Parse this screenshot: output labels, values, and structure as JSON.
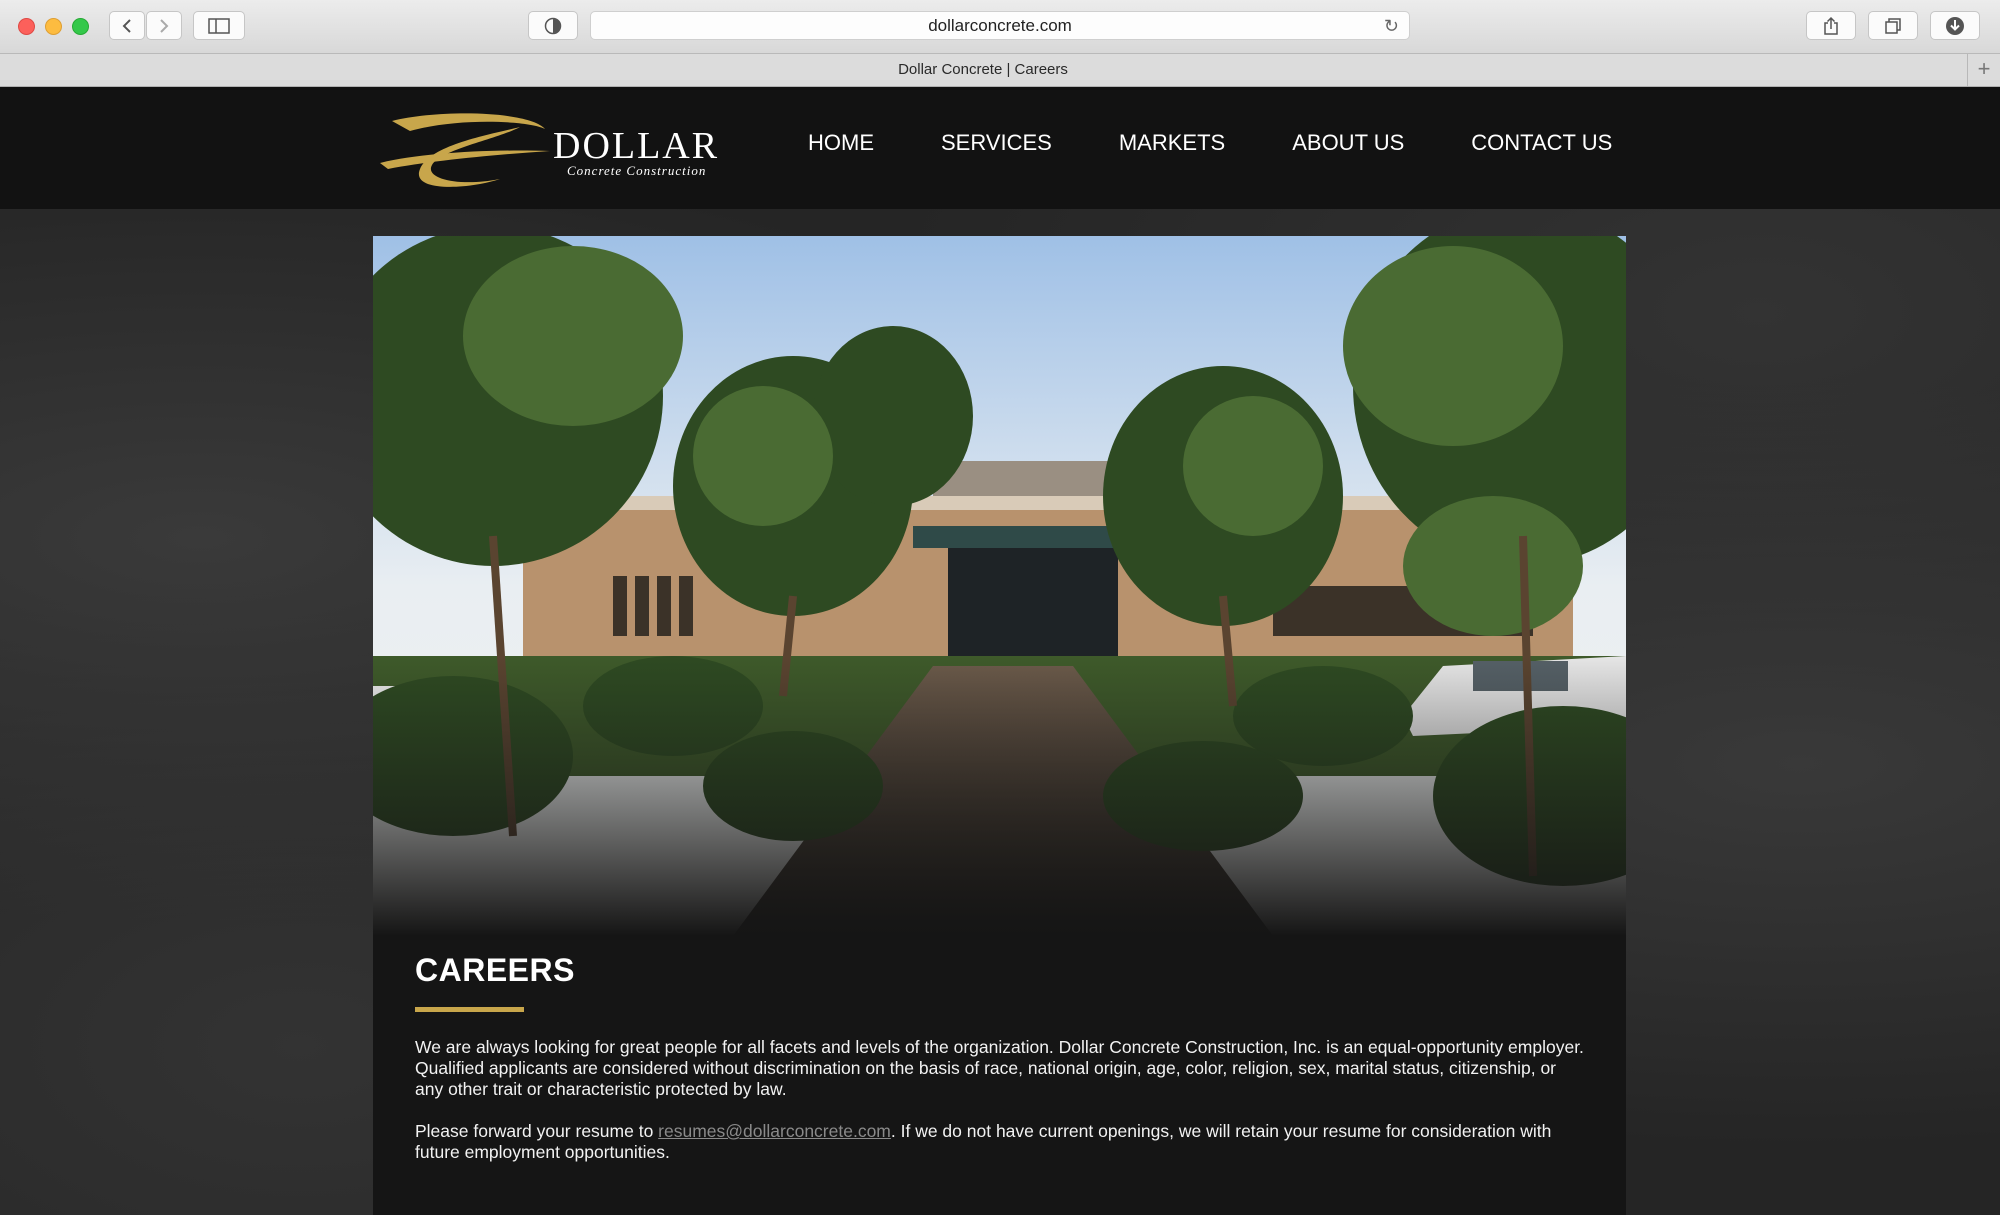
{
  "browser": {
    "url": "dollarconcrete.com",
    "tab_title": "Dollar Concrete | Careers",
    "new_tab_glyph": "+"
  },
  "brand": {
    "name": "DOLLAR",
    "tagline": "Concrete Construction",
    "gold_color": "#c8a64b"
  },
  "nav": {
    "items": [
      "HOME",
      "SERVICES",
      "MARKETS",
      "ABOUT US",
      "CONTACT US"
    ]
  },
  "careers": {
    "heading": "CAREERS",
    "paragraph1": "We are always looking for great people for all facets and levels of the organization. Dollar Concrete Construction, Inc. is an equal-opportunity employer. Qualified applicants are considered without discrimination on the basis of race, national origin, age, color, religion, sex, marital status, citizenship, or any other trait or characteristic protected by law.",
    "paragraph2_before": "Please forward your resume to ",
    "email": "resumes@dollarconcrete.com",
    "paragraph2_after": ".  If we do not have current openings, we will retain your resume for consideration with future employment opportunities."
  }
}
